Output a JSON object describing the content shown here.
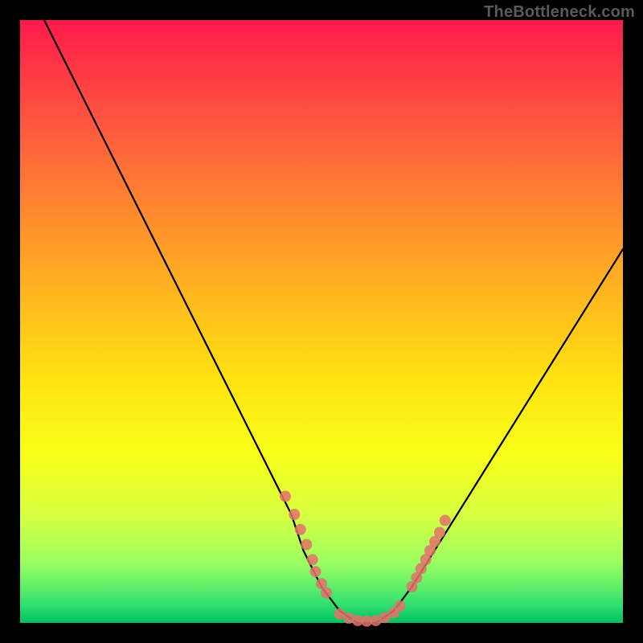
{
  "watermark": "TheBottleneck.com",
  "chart_data": {
    "type": "line",
    "title": "",
    "xlabel": "",
    "ylabel": "",
    "xlim": [
      0,
      100
    ],
    "ylim": [
      0,
      100
    ],
    "grid": false,
    "legend": false,
    "series": [
      {
        "name": "bottleneck-curve",
        "x": [
          4,
          10,
          15,
          20,
          25,
          30,
          35,
          40,
          45,
          47,
          50,
          53,
          56,
          59,
          62,
          65,
          70,
          75,
          80,
          85,
          90,
          95,
          100
        ],
        "y": [
          100,
          88,
          78,
          68,
          58,
          48,
          38,
          28,
          18,
          12,
          6,
          2,
          0,
          0,
          2,
          6,
          14,
          22,
          30,
          38,
          46,
          54,
          62
        ]
      }
    ],
    "marker_clusters": [
      {
        "name": "left-descent-markers",
        "color": "#e2726b",
        "points": [
          {
            "x": 44,
            "y": 21
          },
          {
            "x": 45.5,
            "y": 18
          },
          {
            "x": 46.5,
            "y": 15.5
          },
          {
            "x": 47.5,
            "y": 13
          },
          {
            "x": 48.5,
            "y": 10.5
          },
          {
            "x": 49,
            "y": 8.5
          },
          {
            "x": 50,
            "y": 6.5
          },
          {
            "x": 50.8,
            "y": 5
          }
        ]
      },
      {
        "name": "valley-markers",
        "color": "#e2726b",
        "points": [
          {
            "x": 53,
            "y": 1.5
          },
          {
            "x": 54.5,
            "y": 0.8
          },
          {
            "x": 56,
            "y": 0.4
          },
          {
            "x": 57.5,
            "y": 0.3
          },
          {
            "x": 59,
            "y": 0.4
          },
          {
            "x": 60.5,
            "y": 0.9
          },
          {
            "x": 62,
            "y": 1.7
          },
          {
            "x": 63,
            "y": 2.8
          }
        ]
      },
      {
        "name": "right-ascent-markers",
        "color": "#e2726b",
        "points": [
          {
            "x": 65,
            "y": 6
          },
          {
            "x": 65.8,
            "y": 7.5
          },
          {
            "x": 66.5,
            "y": 9
          },
          {
            "x": 67.3,
            "y": 10.5
          },
          {
            "x": 68,
            "y": 12
          },
          {
            "x": 68.8,
            "y": 13.5
          },
          {
            "x": 69.6,
            "y": 15
          },
          {
            "x": 70.5,
            "y": 17
          }
        ]
      }
    ],
    "gradient_stops": [
      {
        "pos": 0,
        "color": "#ff1a4d"
      },
      {
        "pos": 18,
        "color": "#ff5a3e"
      },
      {
        "pos": 46,
        "color": "#ffb81e"
      },
      {
        "pos": 72,
        "color": "#f8ff18"
      },
      {
        "pos": 90,
        "color": "#9cff60"
      },
      {
        "pos": 100,
        "color": "#00c060"
      }
    ]
  }
}
